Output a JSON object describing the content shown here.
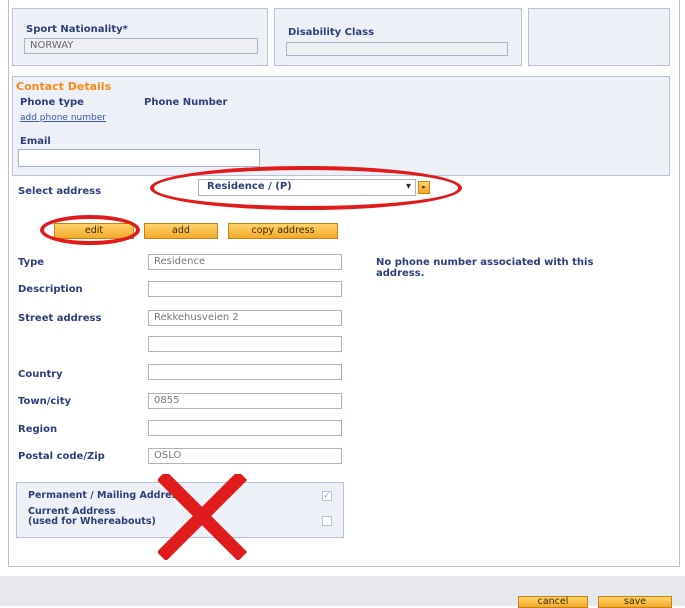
{
  "top": {
    "sport_nationality_label": "Sport Nationality*",
    "sport_nationality_value": "NORWAY",
    "disability_class_label": "Disability Class"
  },
  "contact": {
    "title": "Contact Details",
    "phone_type_label": "Phone type",
    "phone_number_label": "Phone Number",
    "add_phone_link": "add phone number",
    "email_label": "Email",
    "email_value": ""
  },
  "address": {
    "select_label": "Select address",
    "select_value": "Residence / (P)",
    "edit_button": "edit",
    "add_button": "add",
    "copy_button": "copy address",
    "no_phone_message": "No phone number associated with this address.",
    "fields": {
      "type_label": "Type",
      "type_value": "Residence",
      "description_label": "Description",
      "description_value": "",
      "street_label": "Street address",
      "street_value": "Rekkehusveien 2",
      "street2_value": "",
      "country_label": "Country",
      "country_value": "",
      "town_label": "Town/city",
      "town_value": "0855",
      "region_label": "Region",
      "region_value": "",
      "postal_label": "Postal code/Zip",
      "postal_value": "OSLO"
    },
    "permanent_label": "Permanent / Mailing Address",
    "current_label_line1": "Current Address",
    "current_label_line2": "(used for Whereabouts)"
  },
  "footer": {
    "cancel_button": "cancel",
    "save_button": "save"
  },
  "colors": {
    "annotation_red": "#e01b1b",
    "button_orange": "#f3a92a",
    "label_blue": "#2d3f7a",
    "section_orange": "#f08a1a"
  }
}
